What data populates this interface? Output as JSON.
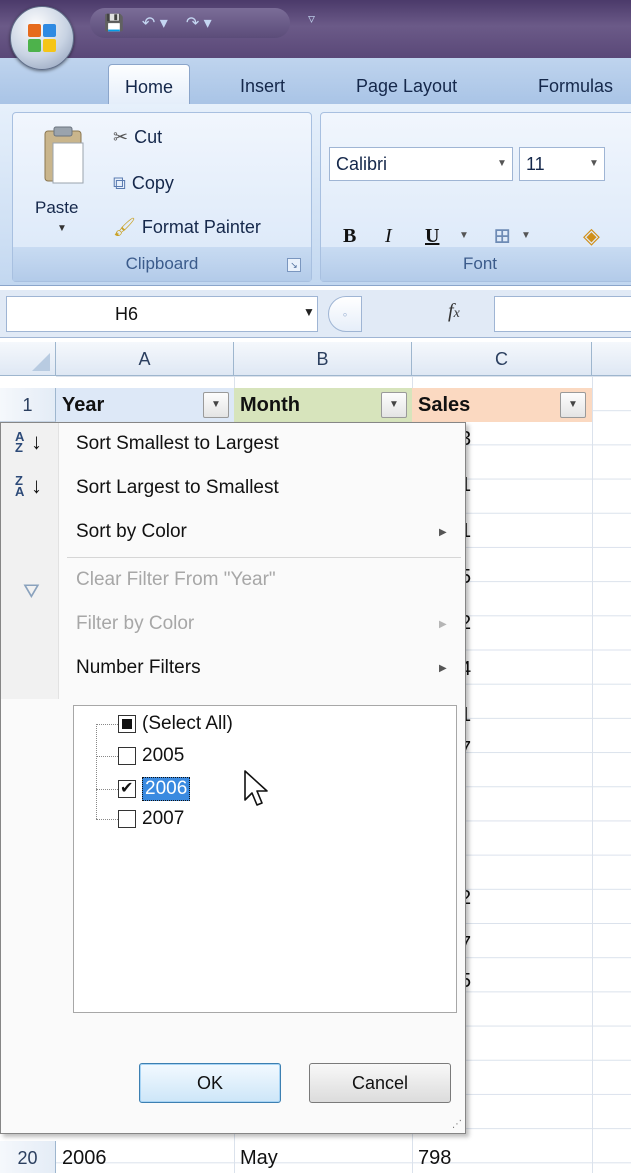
{
  "ribbon_tabs": {
    "home": "Home",
    "insert": "Insert",
    "page_layout": "Page Layout",
    "formulas": "Formulas"
  },
  "clipboard": {
    "paste": "Paste",
    "cut": "Cut",
    "copy": "Copy",
    "format_painter": "Format Painter",
    "group_label": "Clipboard"
  },
  "font": {
    "name": "Calibri",
    "size": "11",
    "bold": "B",
    "italic": "I",
    "underline": "U",
    "group_label": "Font"
  },
  "formula_bar": {
    "name_box": "H6",
    "fx": "fx",
    "value": ""
  },
  "columns": [
    "A",
    "B",
    "C"
  ],
  "row_numbers": {
    "r1": "1",
    "r20": "20"
  },
  "header_row": {
    "a": "Year",
    "b": "Month",
    "c": "Sales"
  },
  "last_row": {
    "a": "2006",
    "b": "May",
    "c": "798"
  },
  "partial_digits": [
    "3",
    "1",
    "1",
    "5",
    "2",
    "4",
    "1",
    "7",
    "",
    "",
    "",
    "",
    "2",
    "7",
    "5"
  ],
  "filter_menu": {
    "sort_asc": "Sort Smallest to Largest",
    "sort_desc": "Sort Largest to Smallest",
    "sort_color": "Sort by Color",
    "clear_filter": "Clear Filter From \"Year\"",
    "filter_color": "Filter by Color",
    "number_filters": "Number Filters",
    "items": [
      {
        "label": "(Select All)",
        "state": "partial"
      },
      {
        "label": "2005",
        "state": "unchecked"
      },
      {
        "label": "2006",
        "state": "checked"
      },
      {
        "label": "2007",
        "state": "unchecked"
      }
    ],
    "ok": "OK",
    "cancel": "Cancel"
  },
  "colors": {
    "year_header": "#dde8f7",
    "month_header": "#d7e4bc",
    "sales_header": "#fbd9c1",
    "selection": "#3a8ae0"
  }
}
